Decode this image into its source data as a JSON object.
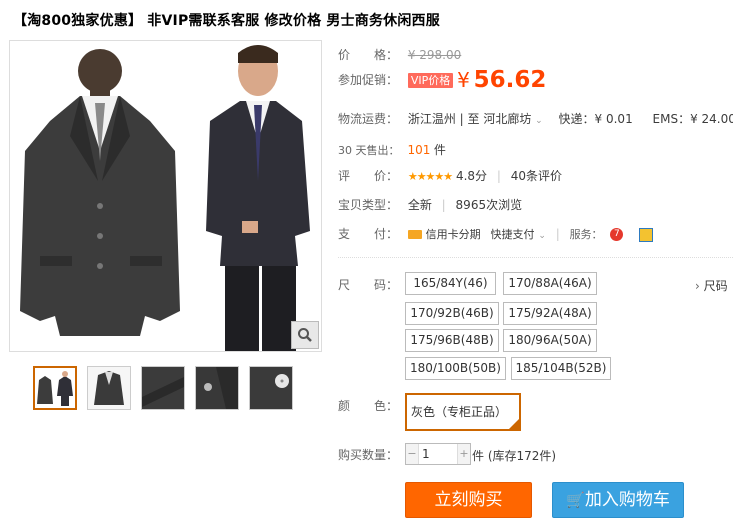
{
  "title": "【淘800独家优惠】 非VIP需联系客服 修改价格 男士商务休闲西服",
  "price": {
    "label": "价　　格：",
    "original": "¥ 298.00"
  },
  "promo": {
    "label": "参加促销：",
    "badge": "VIP价格",
    "currency": "¥",
    "value": "56.62"
  },
  "shipping": {
    "label": "物流运费：",
    "route": "浙江温州 | 至  河北廊坊",
    "express": "快递：¥ 0.01",
    "ems": "EMS：¥ 24.00"
  },
  "sales": {
    "label": "30 天售出：",
    "count": "101",
    "unit": "件"
  },
  "rating": {
    "label": "评　　价：",
    "stars": "★★★★★",
    "score": "4.8分",
    "reviews": "40条评价"
  },
  "item_type": {
    "label": "宝贝类型：",
    "condition": "全新",
    "views": "8965次浏览"
  },
  "payment": {
    "label": "支　　付：",
    "credit": "信用卡分期",
    "quick": "快捷支付",
    "service_label": "服务："
  },
  "size": {
    "label": "尺　　码：",
    "chart_link": "尺码",
    "options": [
      "165/84Y(46)",
      "170/88A(46A)",
      "170/92B(46B)",
      "175/92A(48A)",
      "175/96B(48B)",
      "180/96A(50A)",
      "180/100B(50B)",
      "185/104B(52B)"
    ]
  },
  "color": {
    "label": "颜　　色：",
    "selected": "灰色（专柜正品）"
  },
  "quantity": {
    "label": "购买数量：",
    "value": "1",
    "stock": "件 (库存172件)"
  },
  "actions": {
    "buy": "立刻购买",
    "cart": "加入购物车"
  },
  "colors": {
    "accent": "#ff4400",
    "buy": "#ff6600",
    "cart": "#3aa2e0"
  }
}
